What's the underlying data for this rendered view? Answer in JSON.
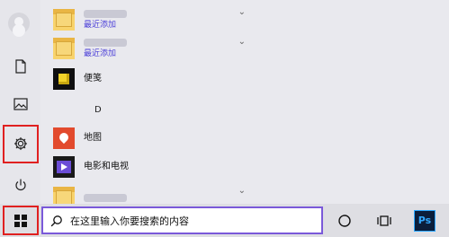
{
  "start_menu": {
    "apps": [
      {
        "name": "",
        "sub": "最近添加",
        "icon": "folder-icon",
        "expandable": true
      },
      {
        "name": "",
        "sub": "最近添加",
        "icon": "folder-icon",
        "expandable": true
      },
      {
        "name": "便笺",
        "sub": "",
        "icon": "sticky-notes-icon",
        "expandable": false
      },
      {
        "name": "地图",
        "sub": "",
        "icon": "maps-icon",
        "expandable": false
      },
      {
        "name": "电影和电视",
        "sub": "",
        "icon": "movies-tv-icon",
        "expandable": false
      },
      {
        "name": "",
        "sub": "",
        "icon": "folder-icon",
        "expandable": true
      }
    ],
    "section_letter": "D"
  },
  "taskbar": {
    "search_placeholder": "在这里输入你要搜索的内容",
    "pinned": [
      {
        "name": "cortana",
        "icon": "circle-icon"
      },
      {
        "name": "task-view",
        "icon": "task-view-icon"
      },
      {
        "name": "photoshop",
        "label": "Ps",
        "icon": "photoshop-icon"
      }
    ]
  },
  "colors": {
    "highlight": "#e02020",
    "accent": "#7a59d9",
    "subtext": "#4b3fd8"
  }
}
